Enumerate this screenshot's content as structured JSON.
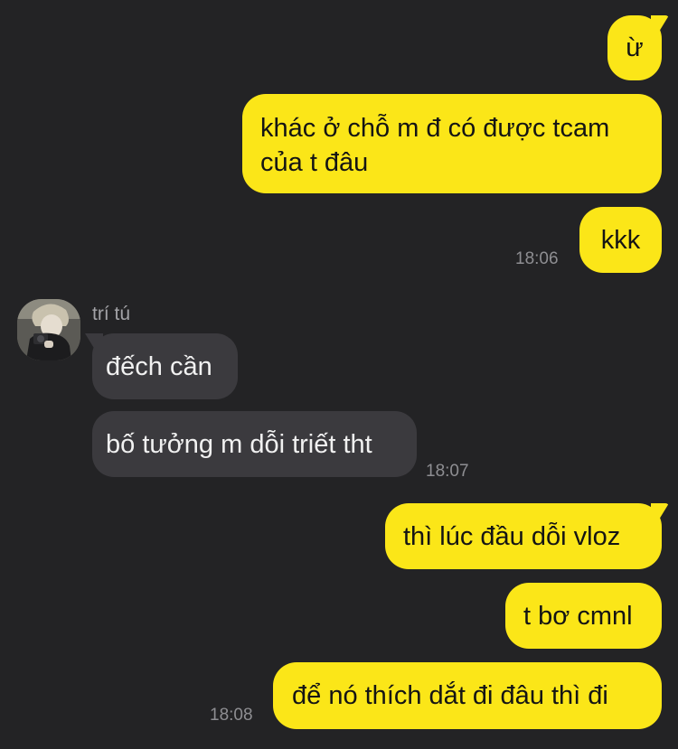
{
  "messages_out_1": [
    {
      "text": "ừ"
    },
    {
      "text": "khác ở chỗ m đ có được tcam của t đâu"
    },
    {
      "text": "kkk"
    }
  ],
  "time_1": "18:06",
  "contact": {
    "name": "trí tú",
    "avatar_icon": "person-holding-camera-icon"
  },
  "messages_in": [
    {
      "text": "đếch cần"
    },
    {
      "text": "bố tưởng m dỗi triết tht"
    }
  ],
  "time_2": "18:07",
  "messages_out_2": [
    {
      "text": "thì lúc đầu dỗi vloz"
    },
    {
      "text": "t bơ cmnl"
    },
    {
      "text": "để nó thích dắt đi đâu thì đi"
    }
  ],
  "time_3": "18:08",
  "colors": {
    "background": "#232325",
    "outgoing_bubble": "#fbe618",
    "incoming_bubble": "#3b3a3e",
    "timestamp": "#8e8e92"
  }
}
